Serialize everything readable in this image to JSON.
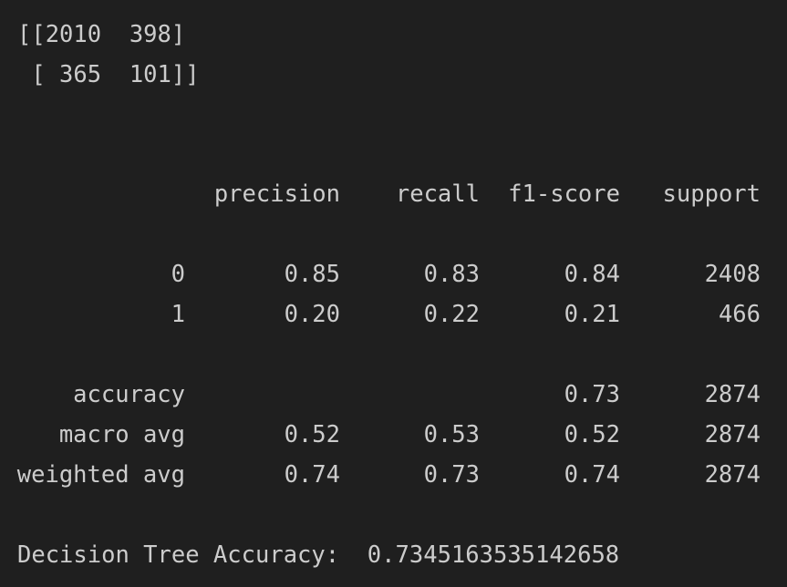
{
  "confusion_matrix": {
    "line1": "[[2010  398]",
    "line2": " [ 365  101]]"
  },
  "report": {
    "headers": {
      "label": "",
      "precision": "precision",
      "recall": "recall",
      "f1": "f1-score",
      "support": "support"
    },
    "rows": [
      {
        "label": "0",
        "precision": "0.85",
        "recall": "0.83",
        "f1": "0.84",
        "support": "2408"
      },
      {
        "label": "1",
        "precision": "0.20",
        "recall": "0.22",
        "f1": "0.21",
        "support": "466"
      },
      {
        "label": "accuracy",
        "precision": "",
        "recall": "",
        "f1": "0.73",
        "support": "2874"
      },
      {
        "label": "macro avg",
        "precision": "0.52",
        "recall": "0.53",
        "f1": "0.52",
        "support": "2874"
      },
      {
        "label": "weighted avg",
        "precision": "0.74",
        "recall": "0.73",
        "f1": "0.74",
        "support": "2874"
      }
    ]
  },
  "accuracy_line": "Decision Tree Accuracy:  0.7345163535142658"
}
